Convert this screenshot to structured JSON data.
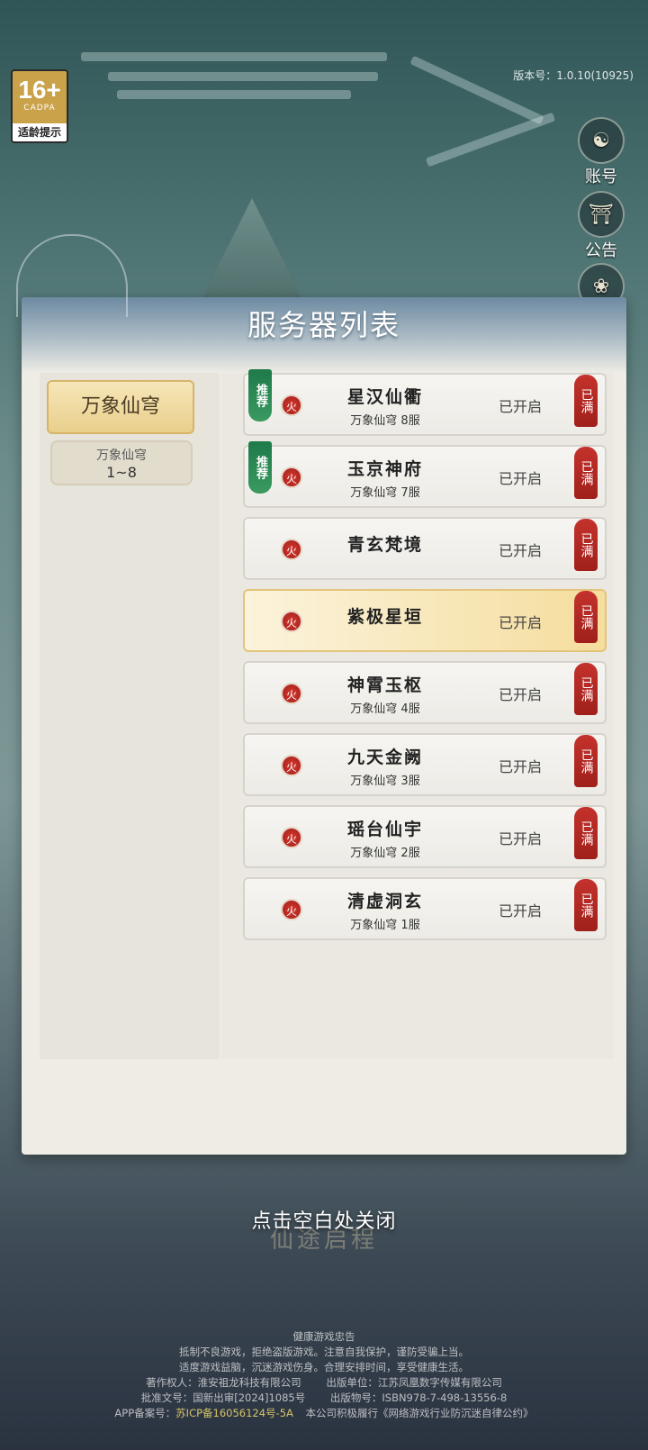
{
  "age_rating": {
    "number": "16+",
    "org": "CADPA",
    "tip": "适龄提示"
  },
  "version": "版本号：1.0.10(10925)",
  "side_buttons": [
    {
      "label": "账号",
      "icon": "account-icon"
    },
    {
      "label": "公告",
      "icon": "notice-icon"
    }
  ],
  "panel": {
    "title": "服务器列表",
    "zones": {
      "active_label": "万象仙穹",
      "sub_name": "万象仙穹",
      "sub_range": "1~8"
    },
    "servers": [
      {
        "name": "星汉仙衢",
        "sub": "万象仙穹  8服",
        "status": "已开启",
        "full": "已满",
        "recommended": "推荐",
        "fire": "火"
      },
      {
        "name": "玉京神府",
        "sub": "万象仙穹  7服",
        "status": "已开启",
        "full": "已满",
        "recommended": "推荐",
        "fire": "火"
      },
      {
        "name": "青玄梵境",
        "sub": "",
        "status": "已开启",
        "full": "已满",
        "recommended": "",
        "fire": "火"
      },
      {
        "name": "紫极星垣",
        "sub": "",
        "status": "已开启",
        "full": "已满",
        "recommended": "",
        "fire": "火",
        "selected": true
      },
      {
        "name": "神霄玉枢",
        "sub": "万象仙穹  4服",
        "status": "已开启",
        "full": "已满",
        "recommended": "",
        "fire": "火"
      },
      {
        "name": "九天金阙",
        "sub": "万象仙穹  3服",
        "status": "已开启",
        "full": "已满",
        "recommended": "",
        "fire": "火"
      },
      {
        "name": "瑶台仙宇",
        "sub": "万象仙穹  2服",
        "status": "已开启",
        "full": "已满",
        "recommended": "",
        "fire": "火"
      },
      {
        "name": "清虚洞玄",
        "sub": "万象仙穹  1服",
        "status": "已开启",
        "full": "已满",
        "recommended": "",
        "fire": "火"
      }
    ]
  },
  "close_hint": "点击空白处关闭",
  "close_hint_bg": "仙途启程",
  "footer": {
    "title": "健康游戏忠告",
    "line1": "抵制不良游戏，拒绝盗版游戏。注意自我保护，谨防受骗上当。",
    "line2": "适度游戏益脑，沉迷游戏伤身。合理安排时间，享受健康生活。",
    "copyright": "著作权人：淮安祖龙科技有限公司",
    "publisher": "出版单位：江苏凤凰数字传媒有限公司",
    "approval": "批准文号：国新出审[2024]1085号",
    "isbn": "出版物号：ISBN978-7-498-13556-8",
    "app_record_label": "APP备案号：",
    "icp": "苏ICP备16056124号-5A",
    "pledge": "本公司积极履行《网络游戏行业防沉迷自律公约》"
  },
  "colors": {
    "accent_gold": "#e9cf8c",
    "full_red": "#c4322c",
    "recommend_green": "#1e7a4a"
  }
}
